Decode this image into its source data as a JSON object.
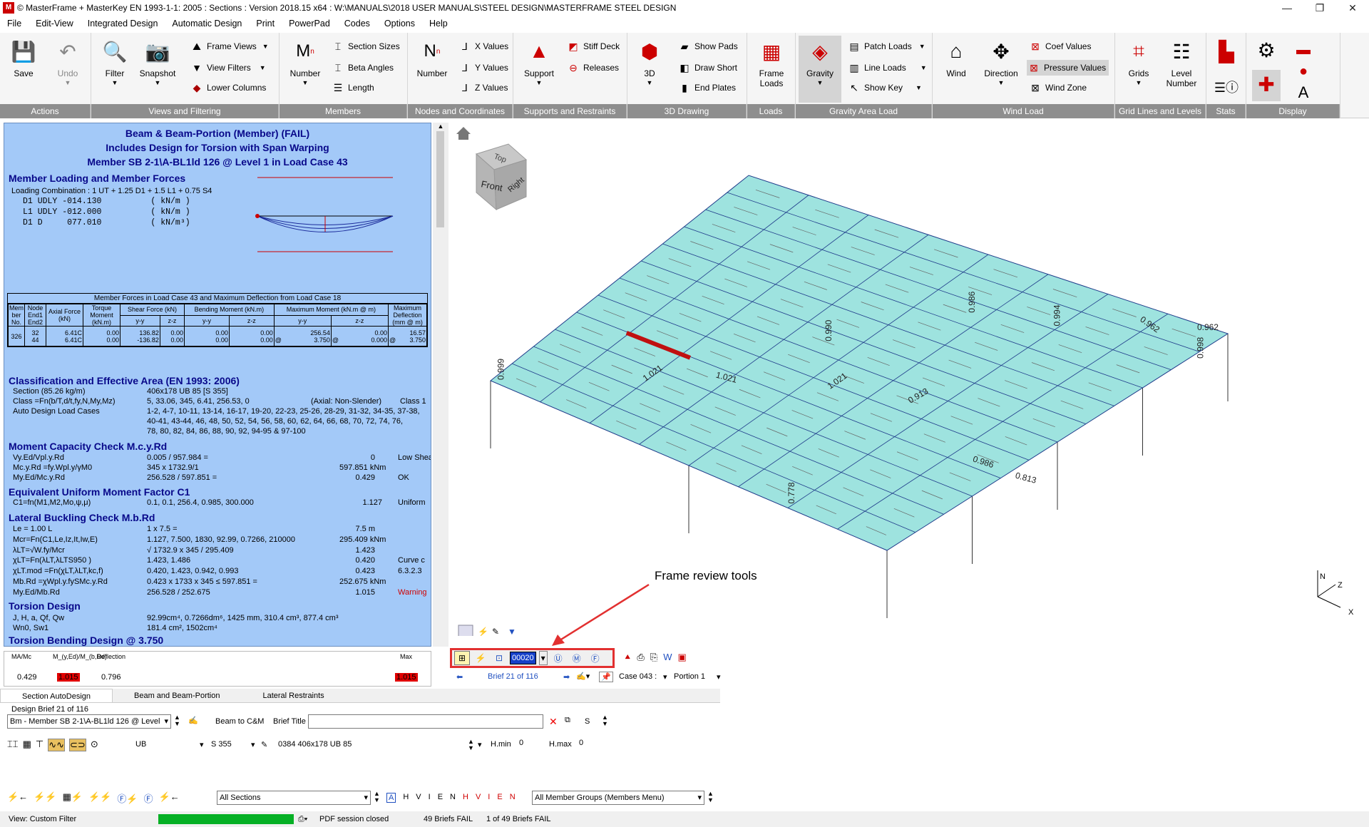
{
  "window": {
    "title": "© MasterFrame + MasterKey EN 1993-1-1: 2005 : Sections : Version 2018.15 x64 : W:\\MANUALS\\2018 USER MANUALS\\STEEL DESIGN\\MASTERFRAME STEEL DESIGN",
    "minimize": "—",
    "maximize": "❐",
    "close": "✕"
  },
  "menu": [
    "File",
    "Edit-View",
    "Integrated Design",
    "Automatic Design",
    "Print",
    "PowerPad",
    "Codes",
    "Options",
    "Help"
  ],
  "ribbon": {
    "groups": [
      "Actions",
      "Views and Filtering",
      "Members",
      "Nodes and Coordinates",
      "Supports and Restraints",
      "3D Drawing",
      "Loads",
      "Gravity Area Load",
      "Wind Load",
      "Grid Lines and Levels",
      "Stats",
      "Display"
    ],
    "save": "Save",
    "undo": "Undo",
    "filter": "Filter",
    "snapshot": "Snapshot",
    "frame_views": "Frame Views",
    "view_filters": "View Filters",
    "lower_columns": "Lower Columns",
    "number_m": "Number",
    "section_sizes": "Section Sizes",
    "beta_angles": "Beta Angles",
    "length": "Length",
    "number_n": "Number",
    "x_values": "X Values",
    "y_values": "Y Values",
    "z_values": "Z Values",
    "support": "Support",
    "stiff_deck": "Stiff Deck",
    "releases": "Releases",
    "three_d": "3D",
    "show_pads": "Show Pads",
    "draw_short": "Draw Short",
    "end_plates": "End Plates",
    "frame_loads": "Frame Loads",
    "gravity": "Gravity",
    "patch_loads": "Patch Loads",
    "line_loads": "Line Loads",
    "show_key": "Show Key",
    "wind": "Wind",
    "direction": "Direction",
    "coef_values": "Coef Values",
    "pressure_values": "Pressure Values",
    "wind_zone": "Wind Zone",
    "grids": "Grids",
    "level_number": "Level Number"
  },
  "report": {
    "title1": "Beam & Beam-Portion (Member) (FAIL)",
    "title2": "Includes Design for Torsion with Span Warping",
    "title3": "Member SB 2-1\\A-BL1ld 126 @ Level 1 in Load Case  43",
    "loading_head": "Member Loading and Member Forces",
    "loading_comb": "Loading Combination : 1 UT + 1.25 D1 + 1.5 L1 + 0.75 S4",
    "load_lines": [
      "D1 UDLY -014.130          ( kN/m )",
      "L1 UDLY -012.000          ( kN/m )",
      "D1 D     077.010          ( kN/m³)"
    ],
    "table_caption": "Member Forces in Load Case 43 and Maximum Deflection from Load Case  18",
    "table_head": [
      "Mem ber No.",
      "Node End1 End2",
      "Axial Force (kN)",
      "Torque Moment (kN.m)",
      "Shear Force (kN)",
      "Bending Moment (kN.m)",
      "Maximum Moment (kN.m @ m)",
      "Maximum Deflection (mm @ m)"
    ],
    "table_sub": [
      "y-y",
      "z-z",
      "y-y",
      "z-z",
      "y-y",
      "z-z"
    ],
    "table_row": {
      "mem": "326",
      "n1": "32",
      "n2": "44",
      "ax1": "6.41C",
      "ax2": "6.41C",
      "tq1": "0.00",
      "tq2": "0.00",
      "sy1": "136.82",
      "sy2": "-136.82",
      "sz1": "0.00",
      "sz2": "0.00",
      "by1": "0.00",
      "by2": "0.00",
      "bz1": "0.00",
      "bz2": "0.00",
      "my1": "256.54",
      "my2": "3.750",
      "mz1": "0.00",
      "mz2": "0.000",
      "at": "@",
      "df1": "16.57",
      "df2": "3.750"
    },
    "class_head": "Classification and Effective Area (EN 1993: 2006)",
    "section_lbl": "Section (85.26 kg/m)",
    "section_val": "406x178 UB 85 [S 355]",
    "class_lbl": "Class =Fn(b/T,d/t,fy,N,My,Mz)",
    "class_val": "5, 33.06, 345, 6.41, 256.53, 0",
    "axial_ns": "(Axial: Non-Slender)",
    "class_res": "Class 1",
    "auto_lbl": "Auto Design Load Cases",
    "auto_val": [
      "1-2, 4-7, 10-11, 13-14, 16-17, 19-20, 22-23, 25-26, 28-29, 31-32, 34-35, 37-38,",
      "40-41, 43-44, 46, 48, 50, 52, 54, 56, 58, 60, 62, 64, 66, 68, 70, 72, 74, 76,",
      "78, 80, 82, 84, 86, 88, 90, 92, 94-95 & 97-100"
    ],
    "moment_head": "Moment Capacity Check M.c.y.Rd",
    "mc_rows": [
      [
        "Vy.Ed/Vpl.y.Rd",
        "0.005 / 957.984 =",
        "0",
        "Low Shear"
      ],
      [
        "Mc.y.Rd =fy.Wpl.y/γM0",
        "345 x 1732.9/1",
        "597.851 kNm",
        ""
      ],
      [
        "My.Ed/Mc.y.Rd",
        "256.528 / 597.851 =",
        "0.429",
        "OK"
      ]
    ],
    "c1_head": "Equivalent Uniform Moment Factor C1",
    "c1_row": [
      "C1=fn(M1,M2,Mo,ψ,μ)",
      "0.1, 0.1, 256.4, 0.985, 300.000",
      "1.127",
      "Uniform"
    ],
    "lt_head": "Lateral Buckling Check M.b.Rd",
    "lt_rows": [
      [
        "Le = 1.00 L",
        "1 x 7.5 =",
        "7.5 m",
        ""
      ],
      [
        "Mcr=Fn(C1,Le,Iz,It,Iw,E)",
        "1.127, 7.500, 1830, 92.99, 0.7266, 210000",
        "295.409 kNm",
        ""
      ],
      [
        "λLT=√W.fy/Mcr",
        "√ 1732.9 x 345 / 295.409",
        "1.423",
        ""
      ],
      [
        "χLT=Fn(λLT,λLTS950 )",
        "1.423, 1.486",
        "0.420",
        "Curve c"
      ],
      [
        "χLT.mod =Fn(χLT,λLT,kc,f)",
        "0.420, 1.423, 0.942, 0.993",
        "0.423",
        "6.3.2.3"
      ],
      [
        "Mb.Rd =χWpl.y.fySMc.y.Rd",
        "0.423 x 1733 x 345 ≤ 597.851 =",
        "252.675 kNm",
        ""
      ],
      [
        "My.Ed/Mb.Rd",
        "256.528 / 252.675",
        "1.015",
        "Warning"
      ]
    ],
    "tor_head": "Torsion Design",
    "tor_rows": [
      [
        "J, H, a, Qf, Qw",
        "92.99cm⁴, 0.7266dm⁶, 1425 mm, 310.4 cm³, 877.4 cm³"
      ],
      [
        "Wn0, Sw1",
        "181.4 cm², 1502cm⁴"
      ]
    ],
    "tb_head": "Torsion Bending Design  @ 3.750"
  },
  "summary": {
    "h1": "MA/Mc",
    "h2": "M_(y,Ed)/M_(b,Rd)",
    "h3": "Deflection",
    "h4": "Max",
    "v1": "0.429",
    "v2": "1.015",
    "v3": "0.796",
    "v4": "1.015"
  },
  "view": {
    "cube_top": "Top",
    "cube_front": "Front",
    "cube_right": "Right",
    "labels": [
      "0.778",
      "1.021",
      "1.021",
      "0.990",
      "0.994",
      "0.962",
      "0.962",
      "0.986",
      "0.999",
      "1.021",
      "0.913",
      "0.986",
      "0.813",
      "0.998"
    ],
    "axis_n": "N",
    "axis_z": "Z",
    "axis_x": "X",
    "annotation": "Frame review tools"
  },
  "frame_tools": {
    "code": "00020",
    "brief": "Brief 21 of 116",
    "case": "Case 043 :",
    "portion": "Portion 1"
  },
  "tabs": [
    "Section AutoDesign",
    "Beam and Beam-Portion",
    "Lateral Restraints"
  ],
  "design": {
    "brief_lbl": "Design Brief 21 of 116",
    "member_sel": "Bm - Member SB 2-1\\A-BL1ld 126 @ Level",
    "beam_cm": "Beam to C&M",
    "brief_title": "Brief Title",
    "s_lbl": "S",
    "sect_type": "UB",
    "grade": "S 355",
    "sect": "0384 406x178 UB 85",
    "hmin": "H.min",
    "hmin_v": "0",
    "hmax": "H.max",
    "hmax_v": "0",
    "sections": "All Sections",
    "flags": [
      "A",
      "H",
      "V",
      "I",
      "E",
      "N",
      "H",
      "V",
      "I",
      "E",
      "N"
    ],
    "groups": "All Member Groups (Members Menu)"
  },
  "status": {
    "view": "View: Custom Filter",
    "pdf": "PDF session closed",
    "fail": "49 Briefs FAIL",
    "of": "1 of 49 Briefs FAIL"
  }
}
